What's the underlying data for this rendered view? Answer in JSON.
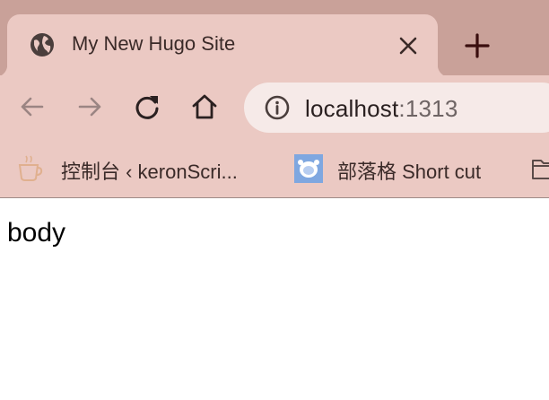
{
  "tab": {
    "title": "My New Hugo Site",
    "favicon": "globe-icon",
    "close_icon": "close-icon"
  },
  "new_tab": {
    "icon": "plus-icon"
  },
  "toolbar": {
    "back_icon": "back-arrow-icon",
    "forward_icon": "forward-arrow-icon",
    "reload_icon": "reload-icon",
    "home_icon": "home-icon"
  },
  "omnibox": {
    "info_icon": "info-icon",
    "host": "localhost",
    "port": ":1313"
  },
  "bookmarks": [
    {
      "label": "控制台 ‹ keronScri...",
      "icon": "cup-icon"
    },
    {
      "label": "部落格 Short cut",
      "icon": "avatar-icon"
    },
    {
      "label": "",
      "icon": "folder-icon"
    }
  ],
  "page": {
    "body_text": "body"
  },
  "colors": {
    "tabstrip": "#c9a199",
    "toolbar": "#ebc9c3",
    "omnibox": "#f6eae8",
    "content": "#ffffff"
  }
}
